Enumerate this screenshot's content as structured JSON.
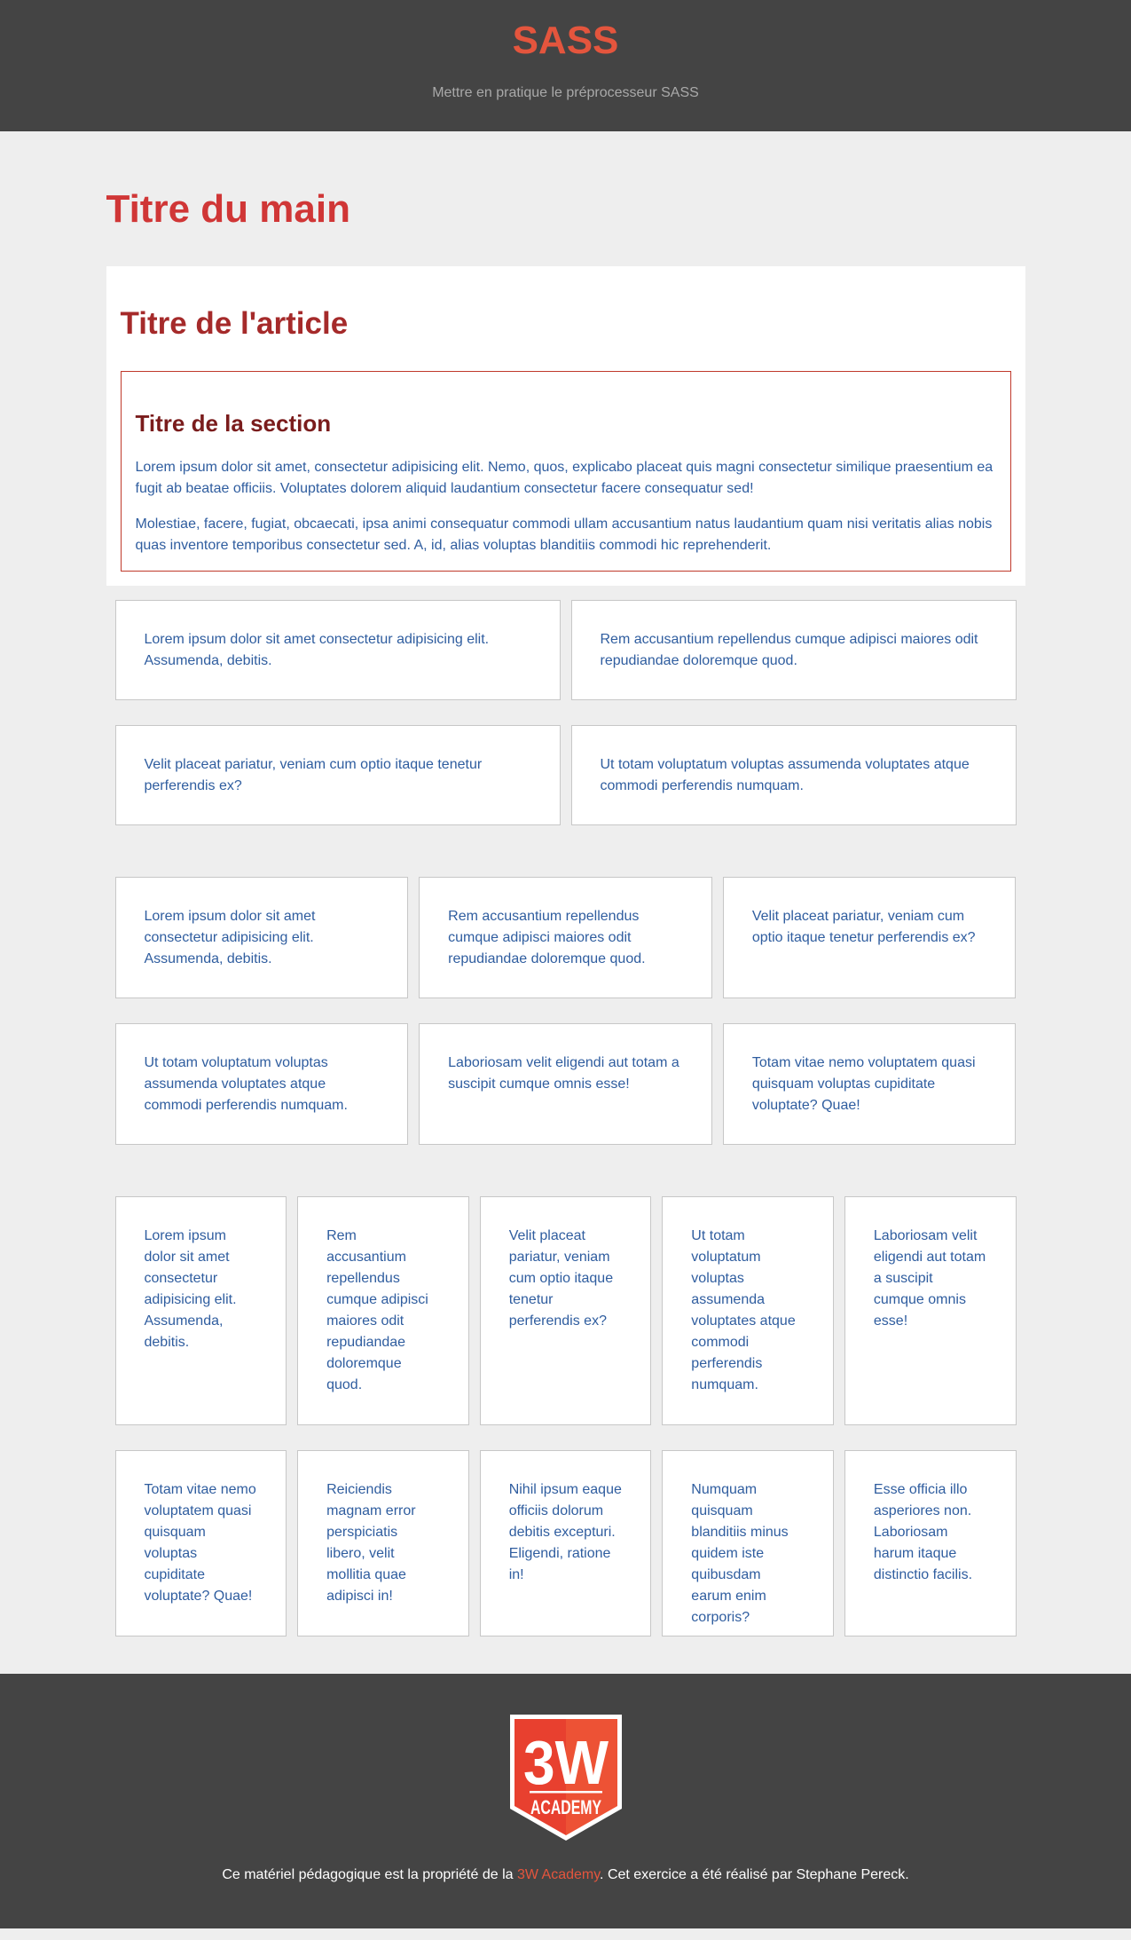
{
  "header": {
    "title": "SASS",
    "subtitle": "Mettre en pratique le préprocesseur SASS"
  },
  "main": {
    "title": "Titre du main",
    "article": {
      "title": "Titre de l'article",
      "section": {
        "title": "Titre de la section",
        "paragraphs": [
          "Lorem ipsum dolor sit amet, consectetur adipisicing elit. Nemo, quos, explicabo placeat quis magni consectetur similique praesentium ea fugit ab beatae officiis. Voluptates dolorem aliquid laudantium consectetur facere consequatur sed!",
          "Molestiae, facere, fugiat, obcaecati, ipsa animi consequatur commodi ullam accusantium natus laudantium quam nisi veritatis alias nobis quas inventore temporibus consectetur sed. A, id, alias voluptas blanditiis commodi hic reprehenderit."
        ]
      }
    },
    "grid_2_cols": [
      "Lorem ipsum dolor sit amet consectetur adipisicing elit. Assumenda, debitis.",
      "Rem accusantium repellendus cumque adipisci maiores odit repudiandae doloremque quod.",
      "Velit placeat pariatur, veniam cum optio itaque tenetur perferendis ex?",
      "Ut totam voluptatum voluptas assumenda voluptates atque commodi perferendis numquam."
    ],
    "grid_3_cols": [
      "Lorem ipsum dolor sit amet consectetur adipisicing elit. Assumenda, debitis.",
      "Rem accusantium repellendus cumque adipisci maiores odit repudiandae doloremque quod.",
      "Velit placeat pariatur, veniam cum optio itaque tenetur perferendis ex?",
      "Ut totam voluptatum voluptas assumenda voluptates atque commodi perferendis numquam.",
      "Laboriosam velit eligendi aut totam a suscipit cumque omnis esse!",
      "Totam vitae nemo voluptatem quasi quisquam voluptas cupiditate voluptate? Quae!"
    ],
    "grid_5_cols": [
      "Lorem ipsum dolor sit amet consectetur adipisicing elit. Assumenda, debitis.",
      "Rem accusantium repellendus cumque adipisci maiores odit repudiandae doloremque quod.",
      "Velit placeat pariatur, veniam cum optio itaque tenetur perferendis ex?",
      "Ut totam voluptatum voluptas assumenda voluptates atque commodi perferendis numquam.",
      "Laboriosam velit eligendi aut totam a suscipit cumque omnis esse!",
      "Totam vitae nemo voluptatem quasi quisquam voluptas cupiditate voluptate? Quae!",
      "Reiciendis magnam error perspiciatis libero, velit mollitia quae adipisci in!",
      "Nihil ipsum eaque officiis dolorum debitis excepturi. Eligendi, ratione in!",
      "Numquam quisquam blanditiis minus quidem iste quibusdam earum enim corporis?",
      "Esse officia illo asperiores non. Laboriosam harum itaque distinctio facilis."
    ]
  },
  "footer": {
    "logo": {
      "number": "3W",
      "word": "ACADEMY",
      "icon": "3w-academy-logo"
    },
    "text_before": "Ce matériel pédagogique est la propriété de la ",
    "link_text": "3W Academy",
    "text_after": ". Cet exercice a été réalisé par Stephane Pereck."
  },
  "colors": {
    "header_bg": "#444444",
    "accent": "#e4553d",
    "main_title": "#d03636",
    "article_title": "#a52a2a",
    "section_title": "#7a1c1c",
    "body_text": "#2f5d9f",
    "page_bg": "#eeeeee"
  }
}
